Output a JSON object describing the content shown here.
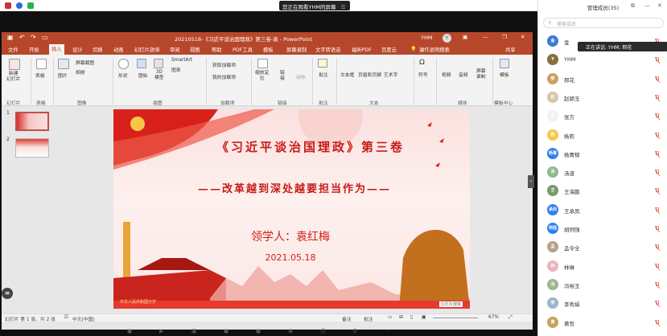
{
  "share_bar": {
    "notice": "您正在观看YHM的屏幕"
  },
  "ppt": {
    "title": "20210518-《习近平谈治国理政》第三卷-袁 - PowerPoint",
    "user": "YHM",
    "user_initial": "Y",
    "tabs": [
      "文件",
      "开始",
      "插入",
      "设计",
      "切换",
      "动画",
      "幻灯片放映",
      "审阅",
      "视图",
      "帮助",
      "PDF工具",
      "模板",
      "屏幕录制",
      "文字转语音",
      "福昕PDF",
      "百度云",
      "操作说明搜索"
    ],
    "active_tab": "插入",
    "share_label": "共享",
    "ribbon": {
      "new_slide": "新建\n幻灯片",
      "table": "表格",
      "image": "图片",
      "screenshot": "屏幕截图",
      "album": "相册",
      "shape": "形状",
      "icon": "图标",
      "model": "3D\n模型",
      "smartart": "SmartArt",
      "chart": "图表",
      "get_addin": "获取加载项",
      "my_addin": "我的加载项",
      "zoom": "缩放定\n位",
      "link": "链\n接",
      "action": "动作",
      "comment": "批注",
      "textbox": "文本框",
      "header_footer": "页眉和页脚",
      "wordart": "艺术字",
      "symbol": "符号",
      "video": "视频",
      "audio": "音频",
      "screen_record": "屏幕\n录制",
      "template": "模板",
      "groups": [
        "幻灯片",
        "表格",
        "图像",
        "插图",
        "加载项",
        "链接",
        "批注",
        "文本",
        "媒体",
        "模板中心"
      ]
    },
    "slides": [
      "1",
      "2"
    ],
    "slide": {
      "title": "《习近平谈治国理政》第三卷",
      "subtitle": "——改革越到深处越要担当作为——",
      "leader": "领学人：袁红梅",
      "date": "2021.05.18",
      "banner": "中华人民共和国万岁",
      "watermark": "幻灯片放映"
    },
    "status": {
      "slide_info": "幻灯片 第 1 张，共 2 张",
      "language": "中文(中国)",
      "notes": "备注",
      "comments": "批注",
      "zoom": "67%"
    }
  },
  "panel": {
    "title": "管理成员(35)",
    "search_placeholder": "搜索成员",
    "tooltip": "正在讲话: YHM; 邢花",
    "members": [
      {
        "name": "金",
        "avatar": "金",
        "color": "#3a7bd5"
      },
      {
        "name": "YHM",
        "avatar": "Y",
        "color": "#8a6d3b"
      },
      {
        "name": "邢花",
        "avatar": "邢",
        "color": "#c9a063"
      },
      {
        "name": "赵颖玉",
        "avatar": "赵",
        "color": "#d8c4b0"
      },
      {
        "name": "张方",
        "avatar": "张",
        "color": "#f0f0f0"
      },
      {
        "name": "杨莉",
        "avatar": "杨",
        "color": "#f7c948"
      },
      {
        "name": "杨菁郁",
        "avatar": "杨菁郁",
        "color": "#2f80ed"
      },
      {
        "name": "汤道",
        "avatar": "汤",
        "color": "#8fb98f"
      },
      {
        "name": "王海鹏",
        "avatar": "王",
        "color": "#7a9a6b"
      },
      {
        "name": "王承凤",
        "avatar": "承凤",
        "color": "#2f80ed"
      },
      {
        "name": "胡例强",
        "avatar": "例强",
        "color": "#2f80ed"
      },
      {
        "name": "孟令全",
        "avatar": "孟",
        "color": "#b7a18c"
      },
      {
        "name": "林琳",
        "avatar": "林",
        "color": "#e8b4c0"
      },
      {
        "name": "冯裕玉",
        "avatar": "冯",
        "color": "#a0b890"
      },
      {
        "name": "李秀娟",
        "avatar": "李",
        "color": "#9fb5c9"
      },
      {
        "name": "黄哲",
        "avatar": "黄",
        "color": "#c8a060"
      }
    ]
  }
}
